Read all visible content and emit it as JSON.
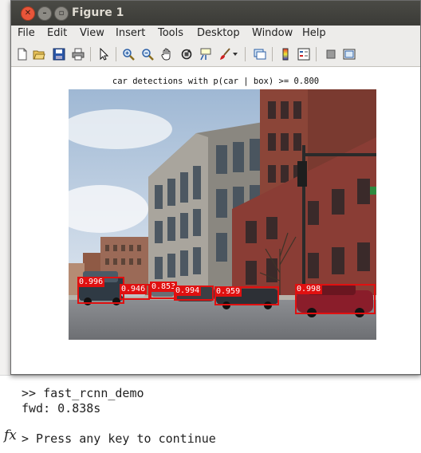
{
  "window": {
    "title": "Figure 1"
  },
  "menubar": {
    "items": [
      {
        "label": "File"
      },
      {
        "label": "Edit"
      },
      {
        "label": "View"
      },
      {
        "label": "Insert"
      },
      {
        "label": "Tools"
      },
      {
        "label": "Desktop"
      },
      {
        "label": "Window"
      },
      {
        "label": "Help"
      }
    ]
  },
  "toolbar": {
    "icons": [
      "new-figure-icon",
      "open-file-icon",
      "save-icon",
      "print-icon",
      "edit-plot-arrow-icon",
      "zoom-in-icon",
      "zoom-out-icon",
      "pan-hand-icon",
      "rotate-3d-icon",
      "data-cursor-icon",
      "brush-icon",
      "link-plot-icon",
      "colorbar-icon",
      "legend-icon",
      "hide-plot-tools-icon",
      "show-plot-tools-icon"
    ]
  },
  "plot": {
    "title": "car detections with p(car | box) >= 0.800",
    "detections": [
      {
        "score": "0.996"
      },
      {
        "score": "0.946"
      },
      {
        "score": "0.853"
      },
      {
        "score": "0.994"
      },
      {
        "score": "0.959"
      },
      {
        "score": "0.998"
      }
    ]
  },
  "command_window": {
    "line1": ">> fast_rcnn_demo",
    "line2": "fwd: 0.838s",
    "prompt_line": "> Press any key to continue",
    "fx_symbol": "fx"
  },
  "colors": {
    "detection_box": "#e01010",
    "titlebar": "#3b3b37",
    "close_button": "#e8553a"
  }
}
